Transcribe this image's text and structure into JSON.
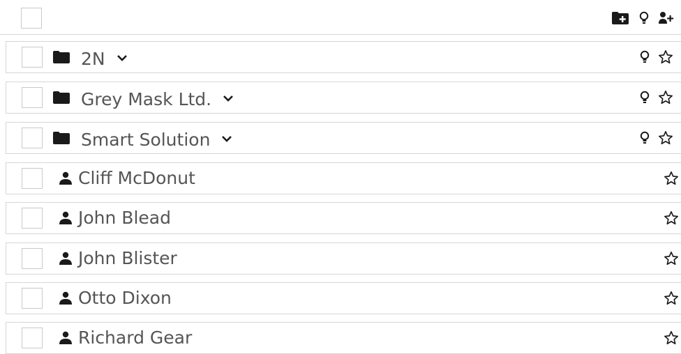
{
  "header": {
    "select_all_icon": "checkbox-empty",
    "actions": [
      {
        "name": "add-folder-icon"
      },
      {
        "name": "lightbulb-icon"
      },
      {
        "name": "add-user-icon"
      }
    ]
  },
  "groups": [
    {
      "label": "2N",
      "icon": "folder-icon",
      "expand_icon": "chevron-down-icon"
    },
    {
      "label": "Grey Mask Ltd.",
      "icon": "folder-icon",
      "expand_icon": "chevron-down-icon"
    },
    {
      "label": "Smart Solution",
      "icon": "folder-icon",
      "expand_icon": "chevron-down-icon"
    }
  ],
  "users": [
    {
      "label": "Cliff McDonut",
      "icon": "user-icon"
    },
    {
      "label": "John Blead",
      "icon": "user-icon"
    },
    {
      "label": "John Blister",
      "icon": "user-icon"
    },
    {
      "label": "Otto Dixon",
      "icon": "user-icon"
    },
    {
      "label": "Richard Gear",
      "icon": "user-icon"
    }
  ],
  "colors": {
    "text": "#555555",
    "icon": "#1a1a1a",
    "border": "#d6d6d6",
    "checkbox_border": "#c9c9c9"
  }
}
